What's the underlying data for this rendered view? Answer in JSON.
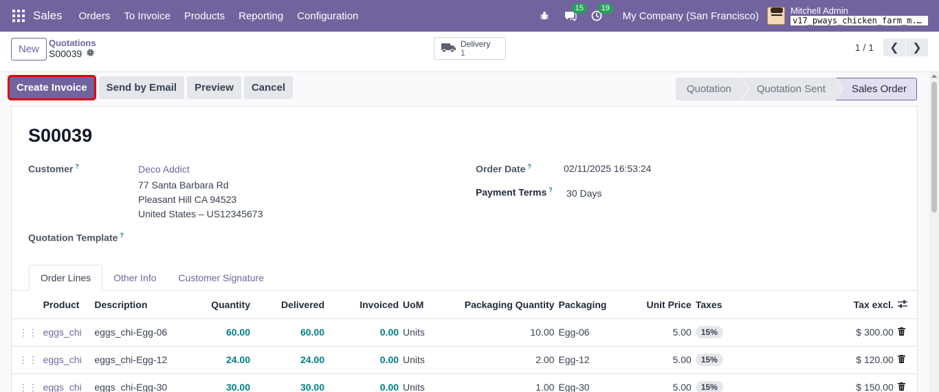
{
  "navbar": {
    "brand": "Sales",
    "menu": [
      "Orders",
      "To Invoice",
      "Products",
      "Reporting",
      "Configuration"
    ],
    "messages_count": "15",
    "activities_count": "19",
    "company": "My Company (San Francisco)",
    "user_name": "Mitchell Admin",
    "db_name": "v17_pways_chicken_farm_m..."
  },
  "control": {
    "new_label": "New",
    "breadcrumb_parent": "Quotations",
    "breadcrumb_current": "S00039",
    "delivery_label": "Delivery",
    "delivery_count": "1",
    "pager_value": "1 / 1"
  },
  "actions": {
    "create_invoice": "Create Invoice",
    "send_email": "Send by Email",
    "preview": "Preview",
    "cancel": "Cancel"
  },
  "stages": [
    "Quotation",
    "Quotation Sent",
    "Sales Order"
  ],
  "active_stage": "Sales Order",
  "form": {
    "name": "S00039",
    "customer_label": "Customer",
    "customer_name": "Deco Addict",
    "address_line1": "77 Santa Barbara Rd",
    "address_line2": "Pleasant Hill CA 94523",
    "address_line3": "United States – US12345673",
    "template_label": "Quotation Template",
    "order_date_label": "Order Date",
    "order_date": "02/11/2025 16:53:24",
    "payment_terms_label": "Payment Terms",
    "payment_terms": "30 Days"
  },
  "tabs": [
    "Order Lines",
    "Other Info",
    "Customer Signature"
  ],
  "table": {
    "headers": {
      "product": "Product",
      "description": "Description",
      "quantity": "Quantity",
      "delivered": "Delivered",
      "invoiced": "Invoiced",
      "uom": "UoM",
      "packaging_qty": "Packaging Quantity",
      "packaging": "Packaging",
      "unit_price": "Unit Price",
      "taxes": "Taxes",
      "tax_excl": "Tax excl."
    },
    "rows": [
      {
        "product": "eggs_chi",
        "description": "eggs_chi-Egg-06",
        "quantity": "60.00",
        "delivered": "60.00",
        "invoiced": "0.00",
        "uom": "Units",
        "packaging_qty": "10.00",
        "packaging": "Egg-06",
        "unit_price": "5.00",
        "taxes": "15%",
        "tax_excl": "$ 300.00"
      },
      {
        "product": "eggs_chi",
        "description": "eggs_chi-Egg-12",
        "quantity": "24.00",
        "delivered": "24.00",
        "invoiced": "0.00",
        "uom": "Units",
        "packaging_qty": "2.00",
        "packaging": "Egg-12",
        "unit_price": "5.00",
        "taxes": "15%",
        "tax_excl": "$ 120.00"
      },
      {
        "product": "eggs_chi",
        "description": "eggs_chi-Egg-30",
        "quantity": "30.00",
        "delivered": "30.00",
        "invoiced": "0.00",
        "uom": "Units",
        "packaging_qty": "1.00",
        "packaging": "Egg-30",
        "unit_price": "5.00",
        "taxes": "15%",
        "tax_excl": "$ 150.00"
      }
    ]
  },
  "colors": {
    "brand": "#71639e",
    "link_teal": "#017e84",
    "highlight_outline": "#e00000",
    "badge_green": "#27a05a"
  }
}
